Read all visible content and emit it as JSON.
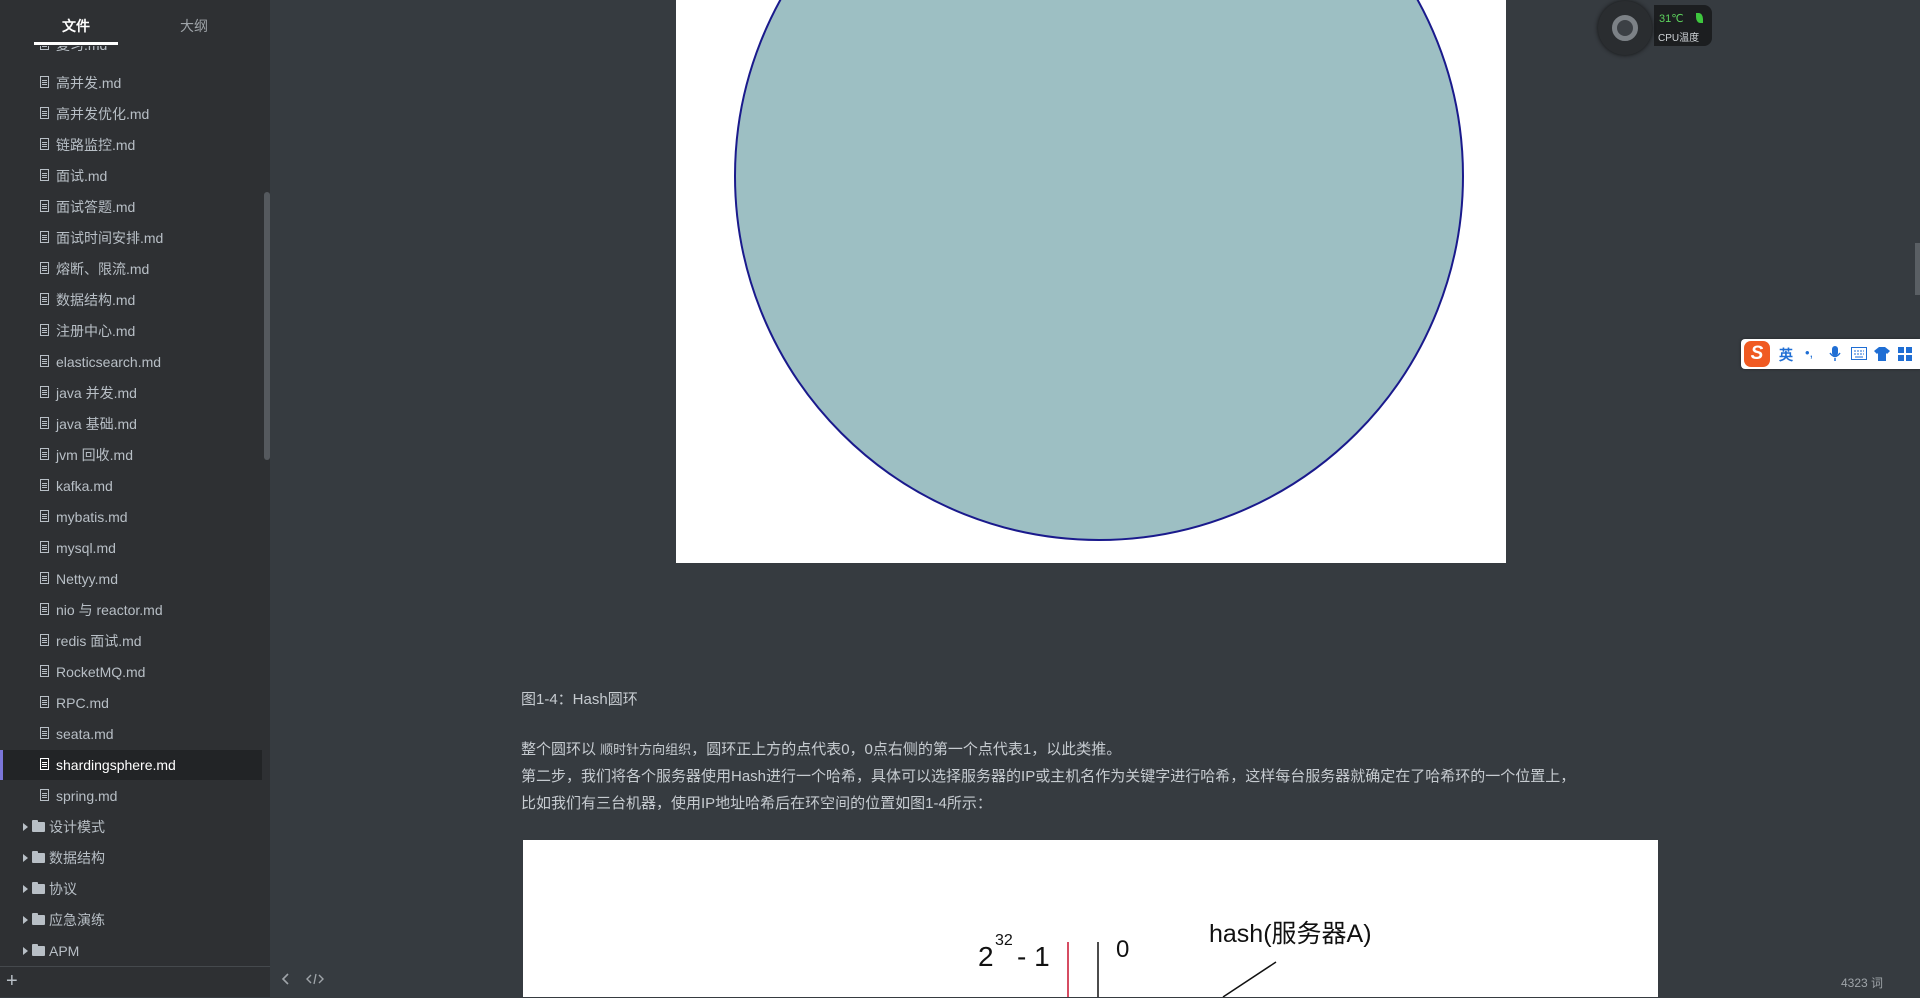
{
  "sidebar": {
    "tabs": [
      {
        "label": "文件",
        "active": true
      },
      {
        "label": "大纲",
        "active": false
      }
    ],
    "partial_top_item": "复习.md",
    "files": [
      {
        "label": "高并发.md"
      },
      {
        "label": "高并发优化.md"
      },
      {
        "label": "链路监控.md"
      },
      {
        "label": "面试.md"
      },
      {
        "label": "面试答题.md"
      },
      {
        "label": "面试时间安排.md"
      },
      {
        "label": "熔断、限流.md"
      },
      {
        "label": "数据结构.md"
      },
      {
        "label": "注册中心.md"
      },
      {
        "label": "elasticsearch.md"
      },
      {
        "label": "java 并发.md"
      },
      {
        "label": "java 基础.md"
      },
      {
        "label": "jvm 回收.md"
      },
      {
        "label": "kafka.md"
      },
      {
        "label": "mybatis.md"
      },
      {
        "label": "mysql.md"
      },
      {
        "label": "Nettyy.md"
      },
      {
        "label": "nio 与 reactor.md"
      },
      {
        "label": "redis 面试.md"
      },
      {
        "label": "RocketMQ.md"
      },
      {
        "label": "RPC.md"
      },
      {
        "label": "seata.md"
      },
      {
        "label": "shardingsphere.md",
        "active": true
      },
      {
        "label": "spring.md"
      }
    ],
    "folders": [
      {
        "label": "设计模式"
      },
      {
        "label": "数据结构"
      },
      {
        "label": "协议"
      },
      {
        "label": "应急演练"
      },
      {
        "label": "APM"
      }
    ],
    "add_label": "+",
    "active_color": "#7b76d9"
  },
  "document": {
    "caption": "图1-4：Hash圆环",
    "para1_a": "整个圆环以 ",
    "para1_small": "顺时针方向组织",
    "para1_b": "，圆环正上方的点代表0，0点右侧的第一个点代表1，以此类推。",
    "para2": "第二步，我们将各个服务器使用Hash进行一个哈希，具体可以选择服务器的IP或主机名作为关键字进行哈希，这样每台服务器就确定在了哈希环的一个位置上，",
    "para3": "比如我们有三台机器，使用IP地址哈希后在环空间的位置如图1-4所示：",
    "figure2": {
      "label_max_base": "2",
      "label_max_exp": "32",
      "label_max_rest": "- 1",
      "label_zero": "0",
      "label_hash": "hash(服务器A)"
    },
    "circle_fill": "#9dbfc3",
    "circle_stroke": "#1a1a8c"
  },
  "status": {
    "word_count": "4323 词",
    "prev_icon": "chevron-left-icon",
    "source_icon": "code-icon"
  },
  "cpu_widget": {
    "temp": "31℃",
    "label": "CPU温度"
  },
  "ime": {
    "lang": "英",
    "icons": [
      "punctuation-icon",
      "microphone-icon",
      "keyboard-icon",
      "shirt-icon",
      "grid-icon"
    ]
  }
}
